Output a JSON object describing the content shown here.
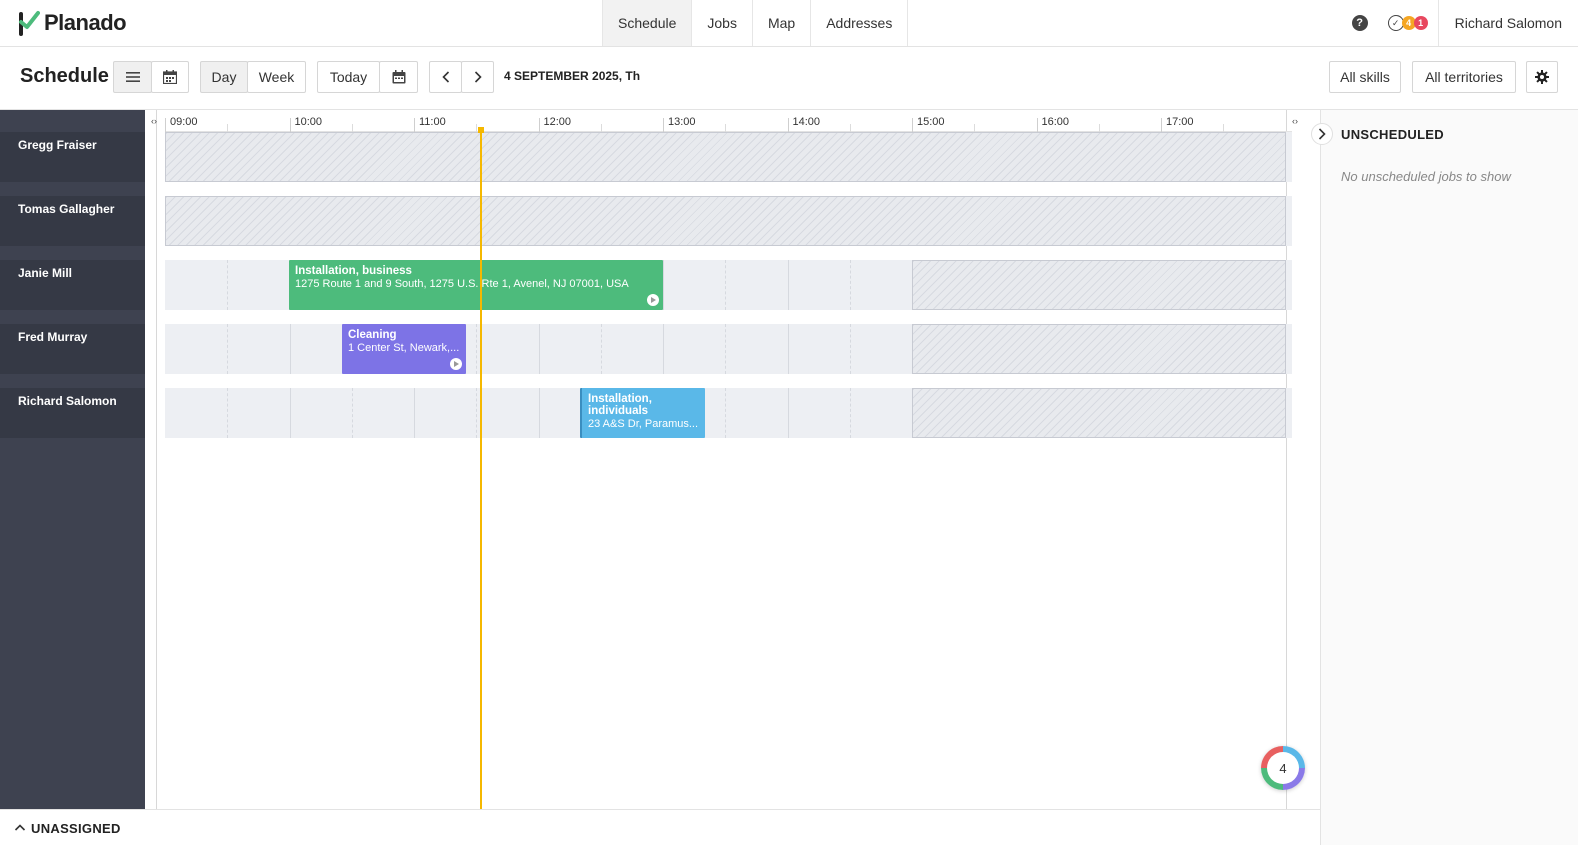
{
  "app": {
    "name": "Planado"
  },
  "nav": {
    "items": [
      "Schedule",
      "Jobs",
      "Map",
      "Addresses"
    ],
    "active": "Schedule"
  },
  "header": {
    "help": "?",
    "notif_badge_orange": "4",
    "notif_badge_red": "1",
    "user": "Richard Salomon"
  },
  "toolbar": {
    "title": "Schedule",
    "day": "Day",
    "week": "Week",
    "today": "Today",
    "date": "4 SEPTEMBER 2025, Th",
    "skills": "All skills",
    "territories": "All territories"
  },
  "timeline": {
    "hours": [
      "09:00",
      "10:00",
      "11:00",
      "12:00",
      "13:00",
      "14:00",
      "15:00",
      "16:00",
      "17:00"
    ]
  },
  "resources": [
    {
      "name": "Gregg Fraiser"
    },
    {
      "name": "Tomas Gallagher"
    },
    {
      "name": "Janie Mill"
    },
    {
      "name": "Fred Murray"
    },
    {
      "name": "Richard Salomon"
    }
  ],
  "jobs": [
    {
      "title": "Installation, business",
      "address": "1275 Route 1 and 9 South, 1275 U.S. Rte 1, Avenel, NJ 07001, USA",
      "color": "#4dbb7c"
    },
    {
      "title": "Cleaning",
      "address": "1 Center St, Newark,...",
      "color": "#7d73e6"
    },
    {
      "title": "Installation, individuals",
      "address": "23 A&S Dr, Paramus...",
      "color": "#5ab8e8"
    }
  ],
  "unscheduled": {
    "title": "UNSCHEDULED",
    "empty": "No unscheduled jobs to show"
  },
  "unassigned": {
    "title": "UNASSIGNED"
  },
  "fab": {
    "count": "4"
  },
  "colors": {
    "now_line": "#f5b800",
    "sidebar": "#3e4250"
  }
}
